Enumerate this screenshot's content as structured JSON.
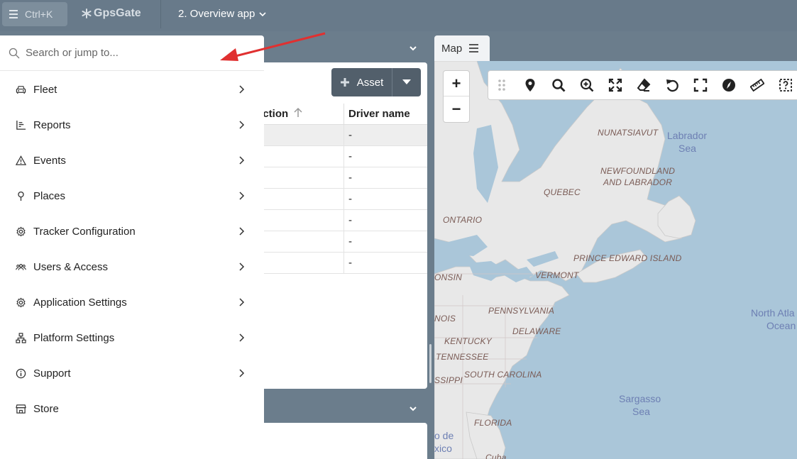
{
  "topbar": {
    "menu_shortcut": "Ctrl+K",
    "logo_text": "GpsGate",
    "app_title": "2. Overview app"
  },
  "search": {
    "placeholder": "Search or jump to..."
  },
  "nav": {
    "items": [
      {
        "label": "Fleet",
        "icon": "car-icon",
        "has_submenu": true
      },
      {
        "label": "Reports",
        "icon": "bar-chart-icon",
        "has_submenu": true
      },
      {
        "label": "Events",
        "icon": "warning-icon",
        "has_submenu": true
      },
      {
        "label": "Places",
        "icon": "pin-icon",
        "has_submenu": true
      },
      {
        "label": "Tracker Configuration",
        "icon": "gear-icon",
        "has_submenu": true
      },
      {
        "label": "Users & Access",
        "icon": "users-icon",
        "has_submenu": true
      },
      {
        "label": "Application Settings",
        "icon": "gear-icon",
        "has_submenu": true
      },
      {
        "label": "Platform Settings",
        "icon": "hierarchy-icon",
        "has_submenu": true
      },
      {
        "label": "Support",
        "icon": "info-icon",
        "has_submenu": true
      },
      {
        "label": "Store",
        "icon": "store-icon",
        "has_submenu": false
      }
    ]
  },
  "asset_button": {
    "label": "Asset"
  },
  "table": {
    "columns": [
      "ection",
      "Driver name"
    ],
    "rows": [
      {
        "driver": "-"
      },
      {
        "driver": "-"
      },
      {
        "driver": "-"
      },
      {
        "driver": "-"
      },
      {
        "driver": "-"
      },
      {
        "driver": "-"
      },
      {
        "driver": "-"
      }
    ]
  },
  "map": {
    "tab_label": "Map",
    "zoom_in": "+",
    "zoom_out": "−",
    "land_labels": [
      "NUNATSIAVUT",
      "NEWFOUNDLAND",
      "AND LABRADOR",
      "QUEBEC",
      "ONTARIO",
      "PRINCE EDWARD ISLAND",
      "VERMONT",
      "ONSIN",
      "PENNSYLVANIA",
      "NOIS",
      "DELAWARE",
      "KENTUCKY",
      "TENNESSEE",
      "SOUTH CAROLINA",
      "SSIPPI",
      "FLORIDA",
      "Cuba"
    ],
    "sea_labels": [
      "Labrador",
      "Sea",
      "North Atla",
      "Ocean",
      "Sargasso",
      "Sea",
      "o de",
      "xico"
    ],
    "toolbar_icons": [
      "drag-handle-icon",
      "location-pin-icon",
      "search-icon",
      "zoom-in-icon",
      "expand-icon",
      "eraser-icon",
      "undo-icon",
      "fullscreen-icon",
      "compass-icon",
      "ruler-icon",
      "help-select-icon"
    ]
  },
  "colors": {
    "topbar": "#687a8a",
    "accent_arrow": "#e03030",
    "button": "#525f6b",
    "map_water": "#aac6d9",
    "map_land": "#e6e6e6"
  }
}
